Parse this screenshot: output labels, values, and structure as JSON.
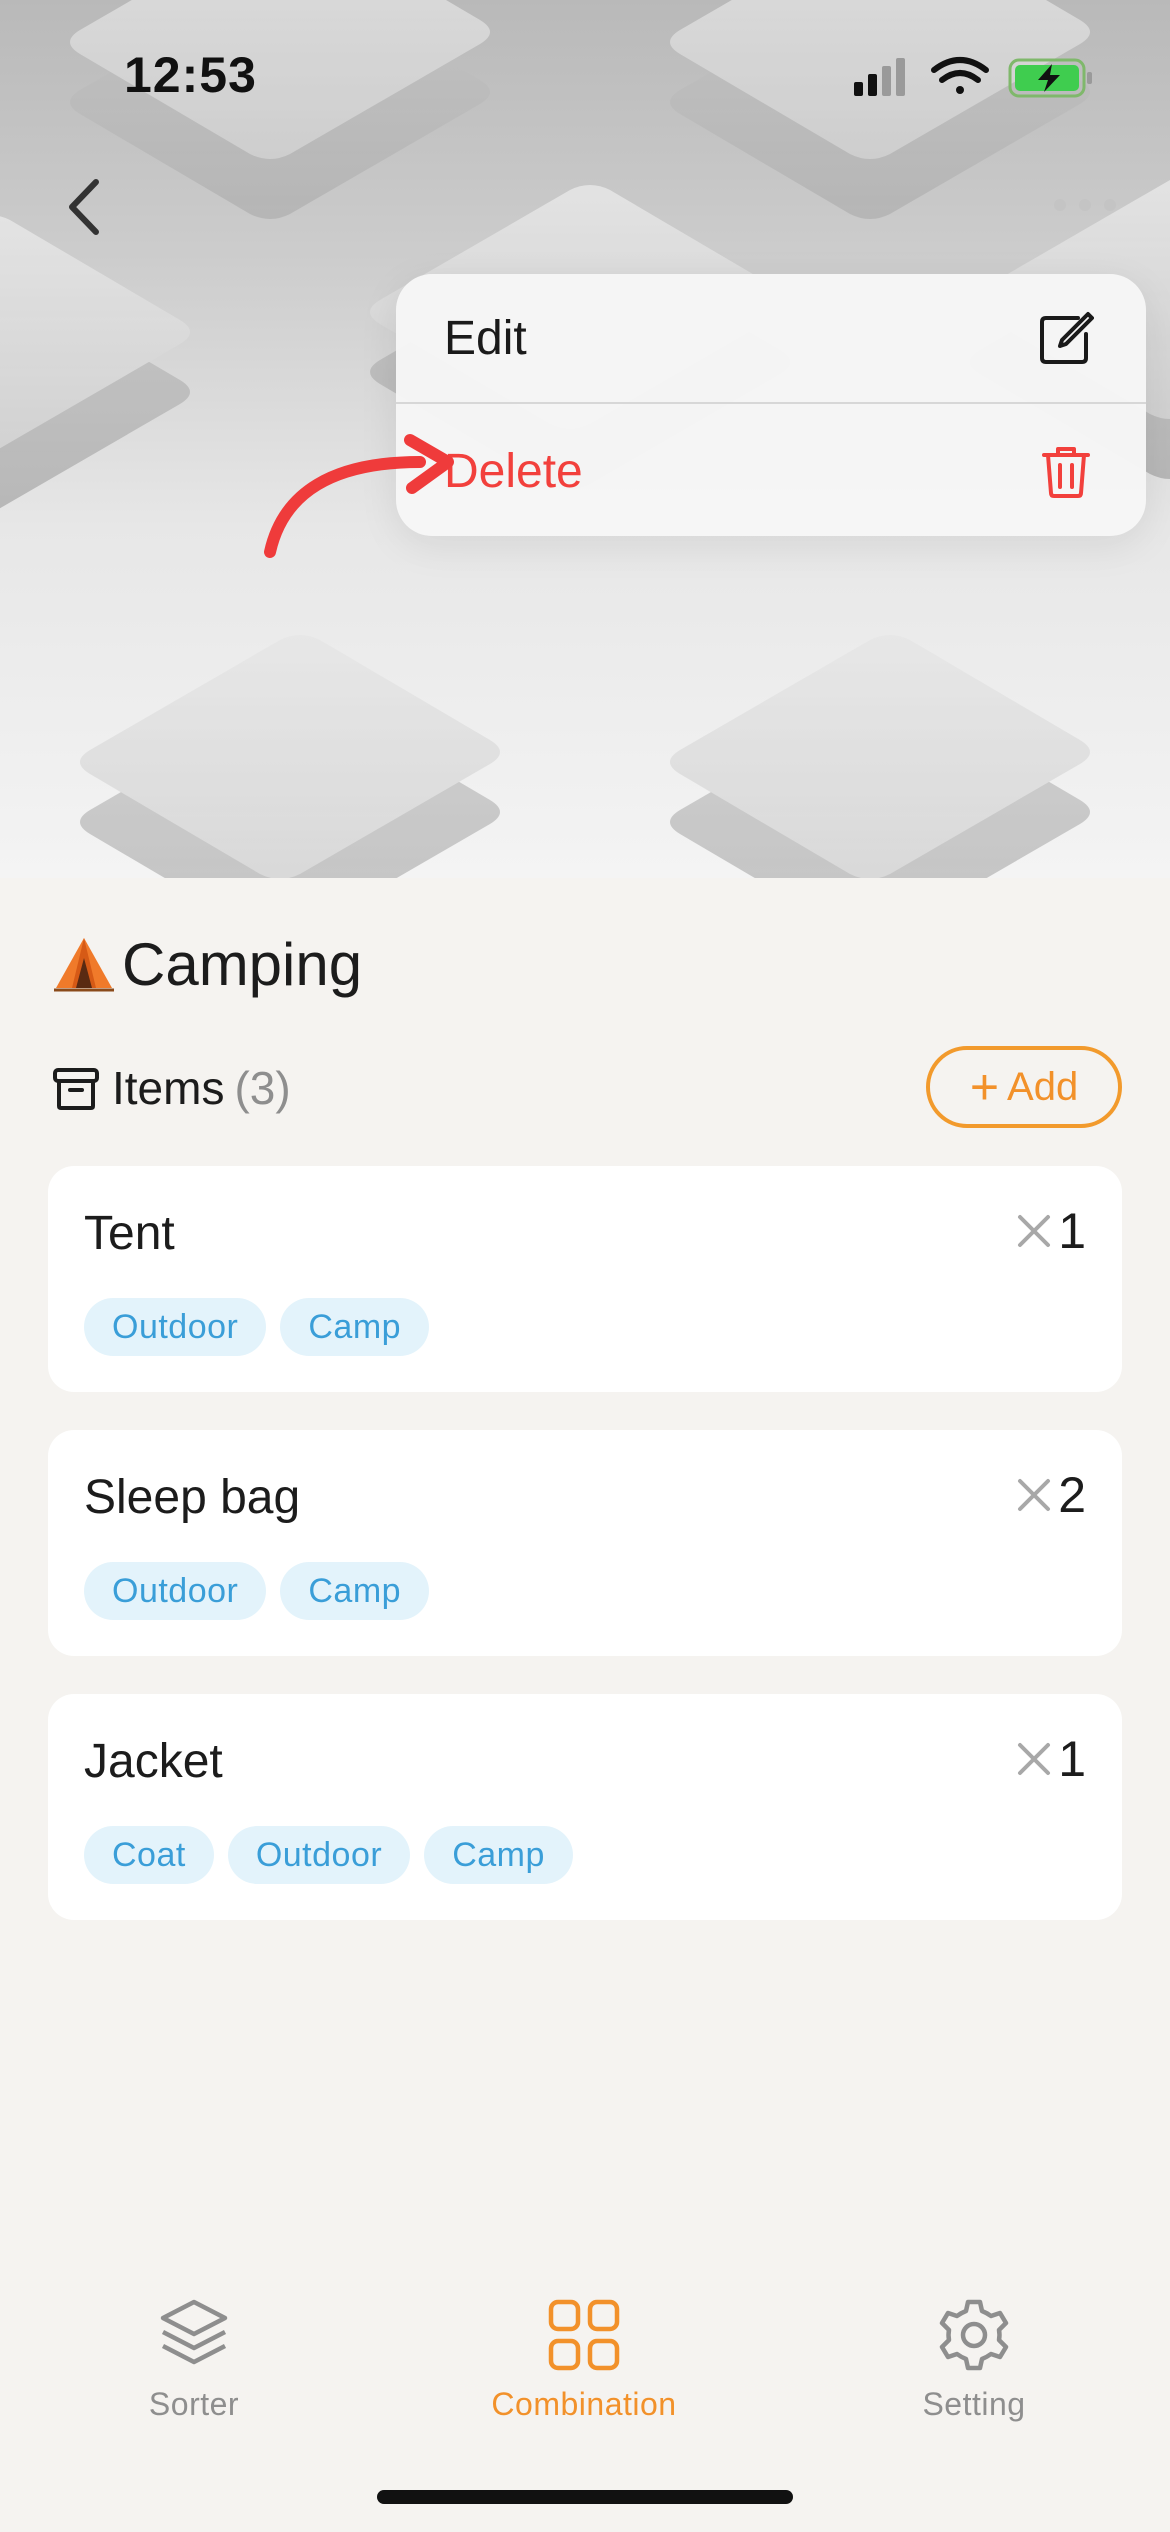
{
  "status_bar": {
    "time": "12:53",
    "icons": [
      "signal-icon",
      "wifi-icon",
      "battery-charging-icon"
    ]
  },
  "nav": {
    "back_icon": "chevron-left-icon",
    "more_icon": "ellipsis-icon"
  },
  "menu": {
    "items": [
      {
        "label": "Edit",
        "icon": "edit-icon"
      },
      {
        "label": "Delete",
        "icon": "trash-icon",
        "color": "#f2403c"
      }
    ]
  },
  "collection": {
    "emoji": "tent-emoji",
    "title": "Camping"
  },
  "items_section": {
    "label": "Items",
    "count": "(3)",
    "add_label": "Add"
  },
  "items": [
    {
      "name": "Tent",
      "quantity": "1",
      "tags": [
        "Outdoor",
        "Camp"
      ]
    },
    {
      "name": "Sleep bag",
      "quantity": "2",
      "tags": [
        "Outdoor",
        "Camp"
      ]
    },
    {
      "name": "Jacket",
      "quantity": "1",
      "tags": [
        "Coat",
        "Outdoor",
        "Camp"
      ]
    }
  ],
  "tabs": [
    {
      "label": "Sorter",
      "icon": "layers-icon",
      "active": false
    },
    {
      "label": "Combination",
      "icon": "grid-icon",
      "active": true
    },
    {
      "label": "Setting",
      "icon": "gear-icon",
      "active": false
    }
  ],
  "colors": {
    "accent": "#f2912a",
    "danger": "#f2403c",
    "tag_bg": "#e3f3fb",
    "tag_text": "#3a9ed8",
    "background": "#f5f3f0"
  }
}
